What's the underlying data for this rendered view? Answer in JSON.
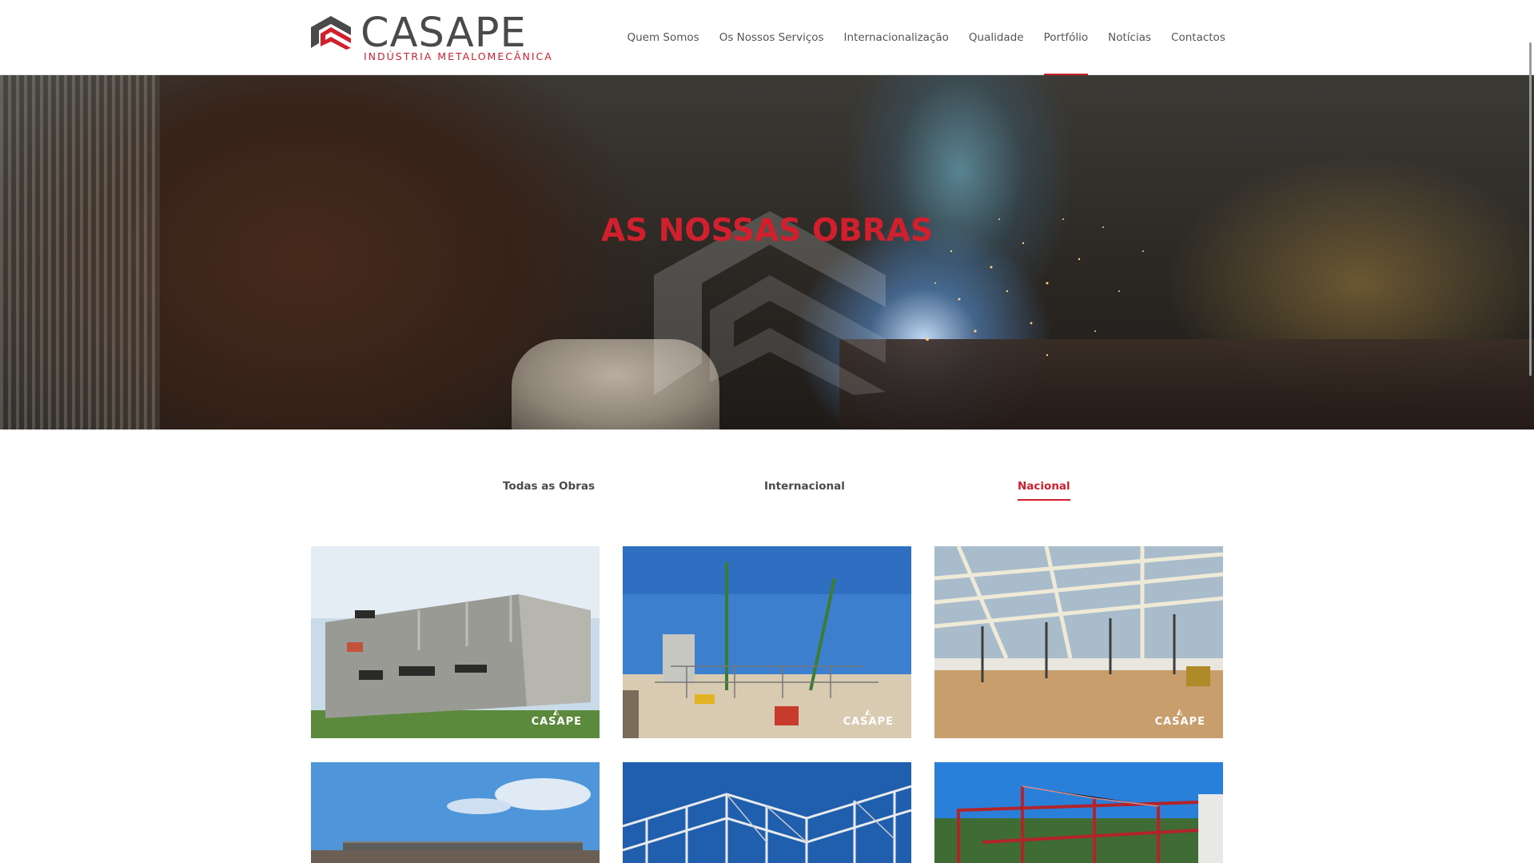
{
  "brand": {
    "name": "CASAPE",
    "tagline": "INDÚSTRIA METALOMECÂNICA",
    "accent": "#d0202e",
    "text_color": "#4a4a4a"
  },
  "nav": {
    "items": [
      {
        "label": "Quem Somos",
        "active": false
      },
      {
        "label": "Os Nossos Serviços",
        "active": false
      },
      {
        "label": "Internacionalização",
        "active": false
      },
      {
        "label": "Qualidade",
        "active": false
      },
      {
        "label": "Portfólio",
        "active": true
      },
      {
        "label": "Notícias",
        "active": false
      },
      {
        "label": "Contactos",
        "active": false
      }
    ]
  },
  "hero": {
    "title": "AS NOSSAS OBRAS"
  },
  "filters": {
    "items": [
      {
        "label": "Todas as Obras",
        "active": false
      },
      {
        "label": "Internacional",
        "active": false
      },
      {
        "label": "Nacional",
        "active": true
      }
    ]
  },
  "portfolio": {
    "watermark": "CASAPE",
    "tiles": [
      {
        "subject": "concrete-block-building",
        "has_watermark": true
      },
      {
        "subject": "crane-construction-site",
        "has_watermark": true
      },
      {
        "subject": "steel-roof-structure",
        "has_watermark": true
      },
      {
        "subject": "warehouse-frame-under-sky",
        "has_watermark": false
      },
      {
        "subject": "multi-storey-steel-frame",
        "has_watermark": false
      },
      {
        "subject": "red-steel-frame",
        "has_watermark": false
      }
    ]
  }
}
